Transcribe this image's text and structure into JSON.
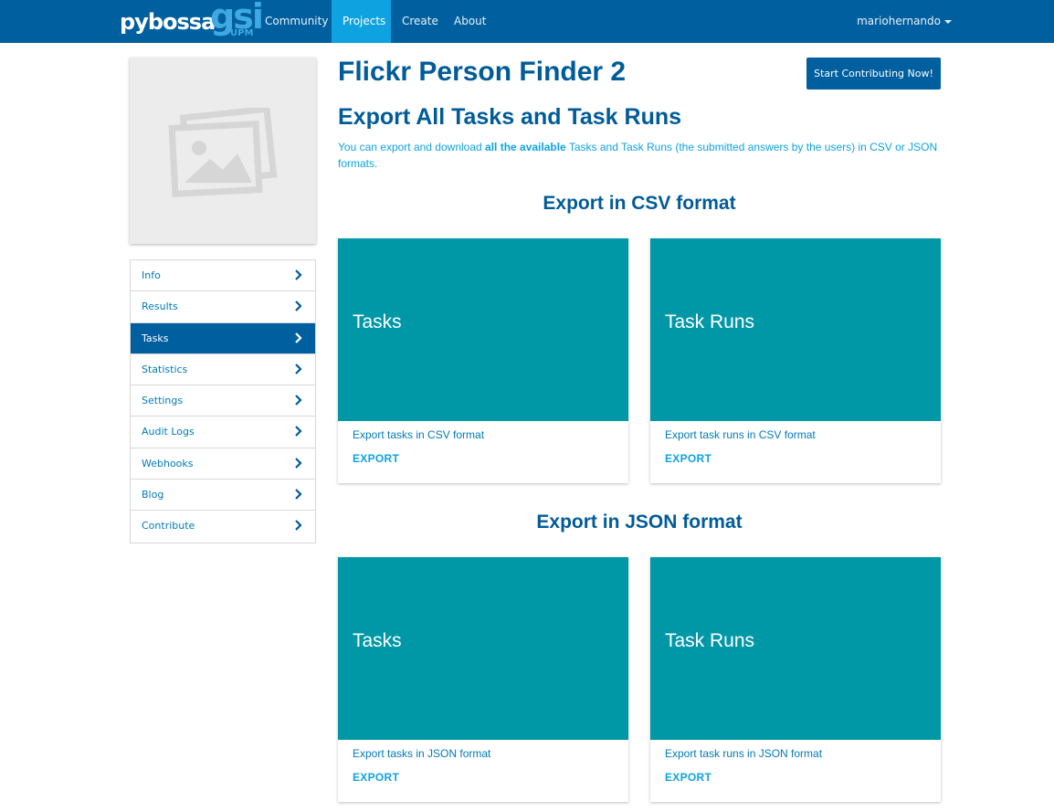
{
  "navbar": {
    "brand": "pybossa",
    "logo_text": "gsi",
    "logo_subtext": "UPM",
    "links": [
      {
        "label": "Community",
        "active": false
      },
      {
        "label": "Projects",
        "active": true
      },
      {
        "label": "Create",
        "active": false
      },
      {
        "label": "About",
        "active": false
      }
    ],
    "user": "mariohernando"
  },
  "sidebar": {
    "thumbnail_icon": "image-placeholder-icon",
    "items": [
      {
        "label": "Info",
        "active": false
      },
      {
        "label": "Results",
        "active": false
      },
      {
        "label": "Tasks",
        "active": true
      },
      {
        "label": "Statistics",
        "active": false
      },
      {
        "label": "Settings",
        "active": false
      },
      {
        "label": "Audit Logs",
        "active": false
      },
      {
        "label": "Webhooks",
        "active": false
      },
      {
        "label": "Blog",
        "active": false
      },
      {
        "label": "Contribute",
        "active": false
      }
    ]
  },
  "main": {
    "project_title": "Flickr Person Finder 2",
    "start_button": "Start Contributing Now!",
    "section_title": "Export All Tasks and Task Runs",
    "intro_before": "You can export and download ",
    "intro_bold": "all the available",
    "intro_after": " Tasks and Task Runs (the submitted answers by the users) in CSV or JSON formats.",
    "csv": {
      "title": "Export in CSV format",
      "cards": [
        {
          "title": "Tasks",
          "desc": "Export tasks in CSV format",
          "action": "EXPORT"
        },
        {
          "title": "Task Runs",
          "desc": "Export task runs in CSV format",
          "action": "EXPORT"
        }
      ]
    },
    "json": {
      "title": "Export in JSON format",
      "cards": [
        {
          "title": "Tasks",
          "desc": "Export tasks in JSON format",
          "action": "EXPORT"
        },
        {
          "title": "Task Runs",
          "desc": "Export task runs in JSON format",
          "action": "EXPORT"
        }
      ]
    }
  },
  "colors": {
    "navbar": "#005f9e",
    "nav_active": "#0ea2e0",
    "card_header": "#0097a7",
    "accent": "#0ea2e0"
  }
}
